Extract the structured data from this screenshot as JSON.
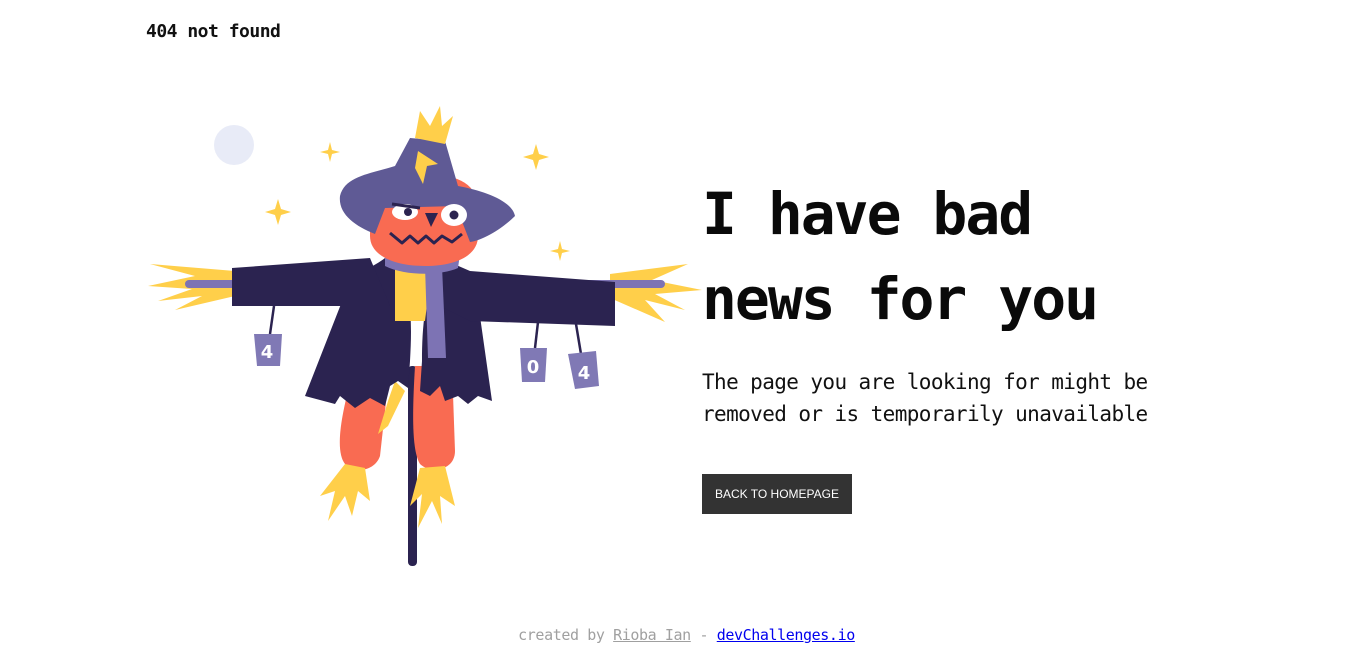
{
  "header": {
    "logo_text": "404 not found"
  },
  "illustration": {
    "can_labels": [
      "4",
      "0",
      "4"
    ],
    "colors": {
      "hat": "#5f5a95",
      "face": "#f96b52",
      "coat": "#2b2350",
      "straw": "#ffcf4a",
      "scarf": "#7d73b4",
      "can": "#8079b5",
      "moon": "#e8ebf7",
      "pole": "#2b2350"
    }
  },
  "main": {
    "headline_line1": "I have bad",
    "headline_line2": "news for you",
    "message_line1": "The page you are looking for might be",
    "message_line2": "removed or is temporarily unavailable",
    "button_label": "BACK TO HOMEPAGE"
  },
  "footer": {
    "prefix": "created by",
    "author": "Rioba Ian",
    "separator": "-",
    "site": "devChallenges.io"
  }
}
